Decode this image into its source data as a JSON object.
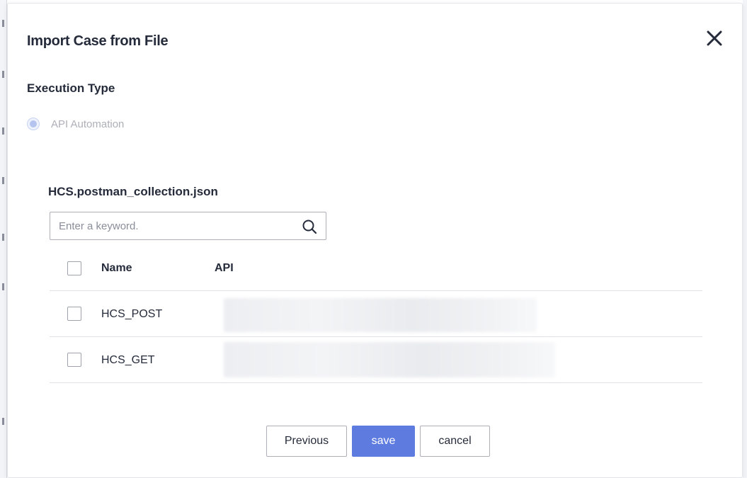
{
  "dialog": {
    "title": "Import Case from File",
    "close_icon": "close-icon"
  },
  "execution_type": {
    "label": "Execution Type",
    "options": [
      {
        "label": "API Automation",
        "selected": true,
        "disabled": true
      }
    ]
  },
  "file": {
    "name": "HCS.postman_collection.json"
  },
  "search": {
    "placeholder": "Enter a keyword.",
    "value": "",
    "icon": "search-icon"
  },
  "table": {
    "columns": [
      "Name",
      "API"
    ],
    "rows": [
      {
        "name": "HCS_POST",
        "api": "",
        "checked": false
      },
      {
        "name": "HCS_GET",
        "api": "",
        "checked": false
      }
    ]
  },
  "footer": {
    "previous_label": "Previous",
    "save_label": "save",
    "cancel_label": "cancel"
  },
  "colors": {
    "primary": "#5e7ce0",
    "text": "#252b3a",
    "border": "#adb0b8",
    "disabled_text": "#adb0b8"
  }
}
